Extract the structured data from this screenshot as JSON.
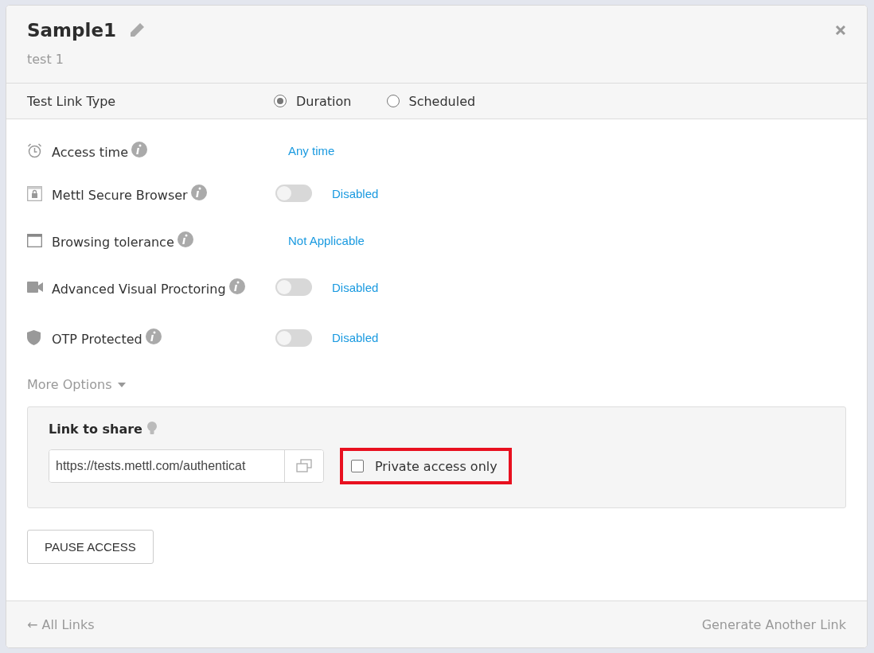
{
  "dialog": {
    "title": "Sample1",
    "subtitle": "test 1"
  },
  "link_type": {
    "label": "Test Link Type",
    "options": [
      {
        "label": "Duration",
        "selected": true
      },
      {
        "label": "Scheduled",
        "selected": false
      }
    ]
  },
  "settings": [
    {
      "label": "Access time",
      "kind": "text",
      "value": "Any time"
    },
    {
      "label": "Mettl Secure Browser",
      "kind": "toggle",
      "on": false,
      "value": "Disabled"
    },
    {
      "label": "Browsing tolerance",
      "kind": "text",
      "value": "Not Applicable"
    },
    {
      "label": "Advanced Visual Proctoring",
      "kind": "toggle",
      "on": false,
      "value": "Disabled"
    },
    {
      "label": "OTP Protected",
      "kind": "toggle",
      "on": false,
      "value": "Disabled"
    }
  ],
  "more_options": {
    "label": "More Options",
    "expanded": false
  },
  "share": {
    "title": "Link to share",
    "url": "https://tests.mettl.com/authenticat",
    "private": {
      "label": "Private access only",
      "checked": false,
      "highlighted": true
    }
  },
  "pause_button": "PAUSE ACCESS",
  "footer": {
    "back": "← All Links",
    "generate": "Generate Another Link"
  }
}
